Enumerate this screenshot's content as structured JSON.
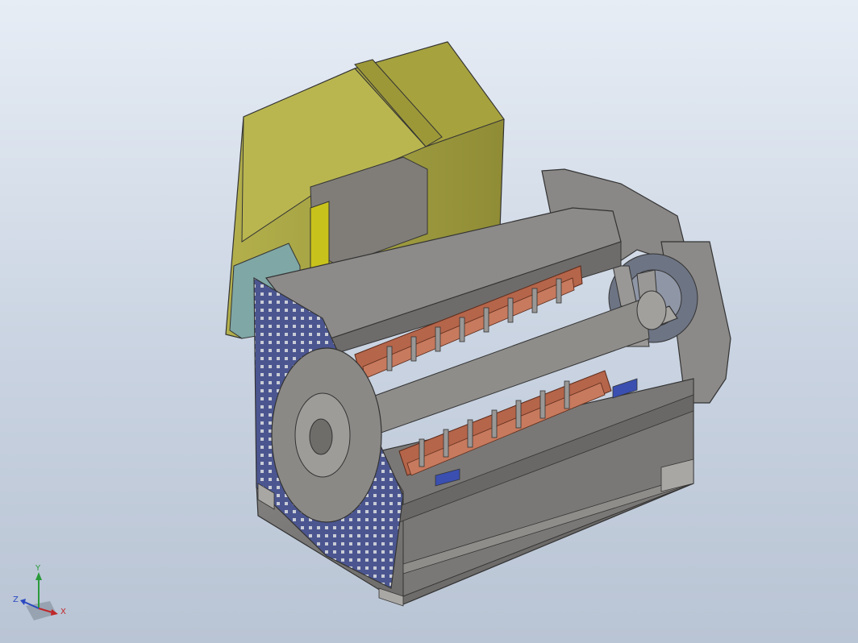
{
  "viewport": {
    "background_top": "#e7edf5",
    "background_bottom": "#b9c4d4"
  },
  "model": {
    "icon": "motor-cutaway-3d-model",
    "colors": {
      "housing": "#7c7a78",
      "housing_dark": "#5c5a58",
      "end_plate": "#4b5690",
      "terminal_box": "#9e9a3e",
      "terminal_box_light": "#b6b24e",
      "copper_winding": "#b5654a",
      "teal_block": "#7fa7a6",
      "yellow_strip": "#c8c21c"
    }
  },
  "triad": {
    "x_label": "X",
    "y_label": "Y",
    "z_label": "Z",
    "x_color": "#c0282a",
    "y_color": "#2a9a3a",
    "z_color": "#2a48c0"
  }
}
